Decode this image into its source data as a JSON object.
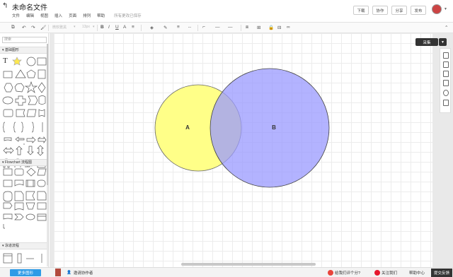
{
  "header": {
    "title": "未命名文件",
    "menu": [
      "文件",
      "编辑",
      "视图",
      "插入",
      "页面",
      "排列",
      "帮助"
    ],
    "save_status": "所有更改已保存",
    "buttons": {
      "download": "下载",
      "collaborate": "协作",
      "share": "分享",
      "publish": "发布"
    }
  },
  "toolbar": {
    "font_family": "微软雅黑",
    "font_size": "13px"
  },
  "sidebar": {
    "search_placeholder": "搜索",
    "sections": {
      "basic": "基础图形",
      "flowchart": "Flowchart 流程图",
      "swimlane": "泳道流程"
    }
  },
  "canvas": {
    "shapes": [
      {
        "kind": "circle",
        "label": "A",
        "fill": "#ffff88",
        "stroke": "#666666"
      },
      {
        "kind": "circle",
        "label": "B",
        "fill": "#9999ff",
        "stroke": "#444444"
      }
    ]
  },
  "right_panel": {
    "collect_label": "采集"
  },
  "bottom": {
    "more_shapes": "更多图形",
    "invite": "邀请协作者",
    "rate": "给我们评个分?",
    "follow": "关注我们",
    "help": "帮助中心",
    "feedback": "提交反馈"
  },
  "colors": {
    "accent": "#2e9be6",
    "circle_a": "#ffff88",
    "circle_b": "#9999ff",
    "dark": "#333333"
  }
}
